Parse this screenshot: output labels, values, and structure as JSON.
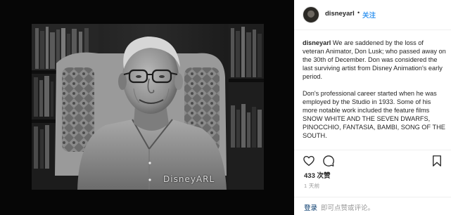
{
  "photo": {
    "watermark": "DisneyARL"
  },
  "post": {
    "username": "disneyarl",
    "separator": "•",
    "follow_label": "关注",
    "caption_username": "disneyarl",
    "caption_p1": "We are saddened by the loss of veteran Animator, Don Lusk; who passed away on the 30th of December. Don was considered the last surviving artist from Disney Animation's early period.",
    "caption_p2": "Don's professional career started when he was employed by the Studio in 1933. Some of his more notable work included the feature films SNOW WHITE AND THE SEVEN DWARFS, PINOCCHIO, FANTASIA, BAMBI, SONG OF THE SOUTH.",
    "likes": "433 次赞",
    "time": "1 天前",
    "login_link": "登录",
    "login_rest": "即可点赞或评论。"
  },
  "icons": {
    "like": "heart-icon",
    "comment": "comment-icon",
    "share": "share-icon",
    "save": "bookmark-icon"
  },
  "colors": {
    "link_blue": "#3897f0",
    "login_link": "#003569",
    "muted": "#999999"
  }
}
